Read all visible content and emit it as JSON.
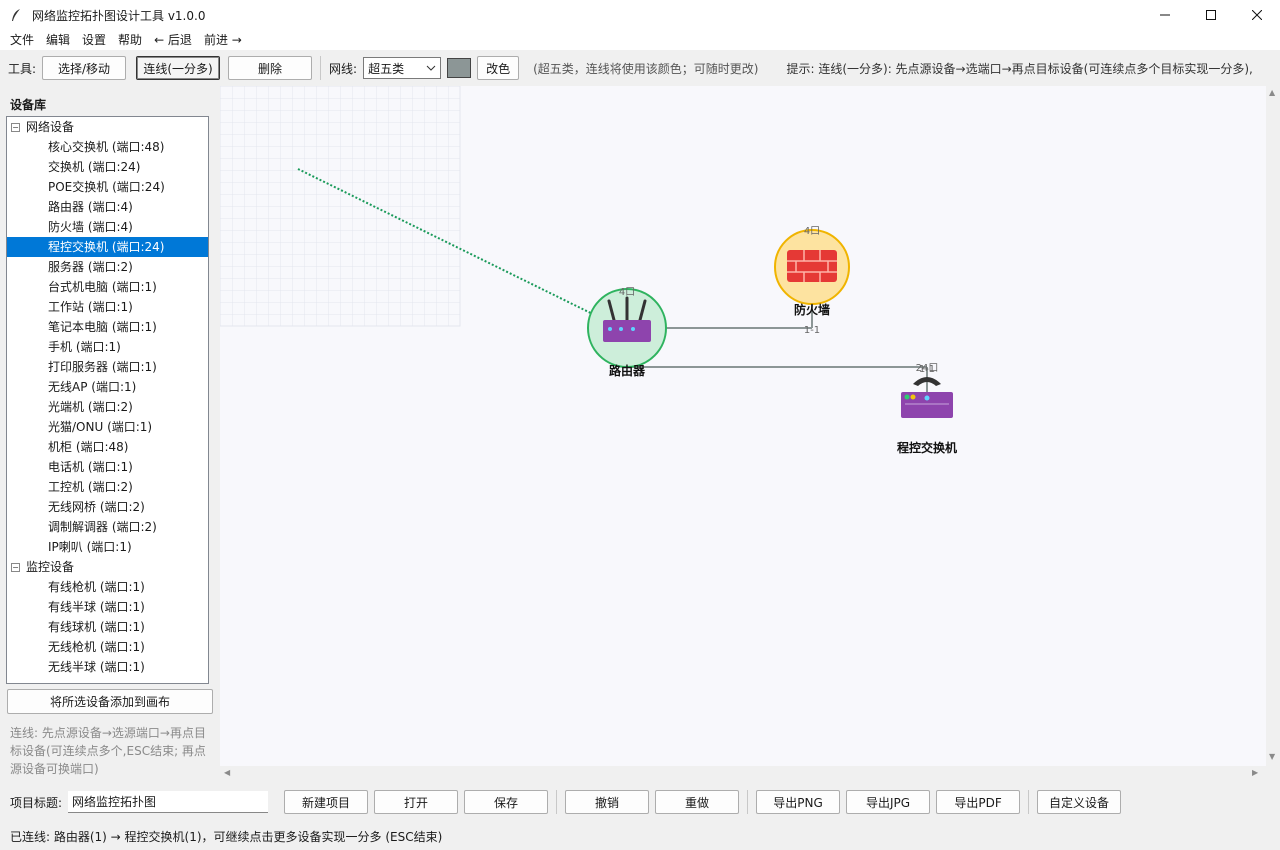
{
  "window": {
    "title": "网络监控拓扑图设计工具 v1.0.0"
  },
  "menu": [
    "文件",
    "编辑",
    "设置",
    "帮助",
    "← 后退",
    "前进 →"
  ],
  "toolbar": {
    "tools_label": "工具:",
    "select_move": "选择/移动",
    "connect": "连线(一分多)",
    "delete": "删除",
    "cable_label": "网线:",
    "cable_value": "超五类",
    "cable_color": "#8c9696",
    "recolor": "改色",
    "cable_hint": "(超五类，连线将使用该颜色；可随时更改)",
    "tip": "提示: 连线(一分多): 先点源设备→选端口→再点目标设备(可连续点多个目标实现一分多),"
  },
  "sidebar": {
    "title": "设备库",
    "groups": [
      {
        "label": "网络设备",
        "items": [
          "核心交换机 (端口:48)",
          "交换机 (端口:24)",
          "POE交换机 (端口:24)",
          "路由器 (端口:4)",
          "防火墙 (端口:4)",
          "程控交换机 (端口:24)",
          "服务器 (端口:2)",
          "台式机电脑 (端口:1)",
          "工作站 (端口:1)",
          "笔记本电脑 (端口:1)",
          "手机 (端口:1)",
          "打印服务器 (端口:1)",
          "无线AP (端口:1)",
          "光端机 (端口:2)",
          "光猫/ONU (端口:1)",
          "机柜 (端口:48)",
          "电话机 (端口:1)",
          "工控机 (端口:2)",
          "无线网桥 (端口:2)",
          "调制解调器 (端口:2)",
          "IP喇叭 (端口:1)"
        ]
      },
      {
        "label": "监控设备",
        "items": [
          "有线枪机 (端口:1)",
          "有线半球 (端口:1)",
          "有线球机 (端口:1)",
          "无线枪机 (端口:1)",
          "无线半球 (端口:1)"
        ]
      }
    ],
    "selected": "程控交换机 (端口:24)",
    "add_button": "将所选设备添加到画布",
    "hint": "连线: 先点源设备→选源端口→再点目标设备(可连续点多个,ESC结束; 再点源设备可换端口)"
  },
  "canvas": {
    "devices": {
      "router": {
        "label": "路由器",
        "ports": "4口"
      },
      "firewall": {
        "label": "防火墙",
        "ports": "4口"
      },
      "pbx": {
        "label": "程控交换机",
        "ports": "24口"
      }
    },
    "links": {
      "router_firewall": "1-1",
      "router_pbx": "1-1"
    }
  },
  "bottombar": {
    "project_label": "项目标题:",
    "project_title": "网络监控拓扑图",
    "buttons": {
      "new": "新建项目",
      "open": "打开",
      "save": "保存",
      "undo": "撤销",
      "redo": "重做",
      "export_png": "导出PNG",
      "export_jpg": "导出JPG",
      "export_pdf": "导出PDF",
      "custom": "自定义设备"
    }
  },
  "status": "已连线: 路由器(1) → 程控交换机(1)，可继续点击更多设备实现一分多 (ESC结束)"
}
